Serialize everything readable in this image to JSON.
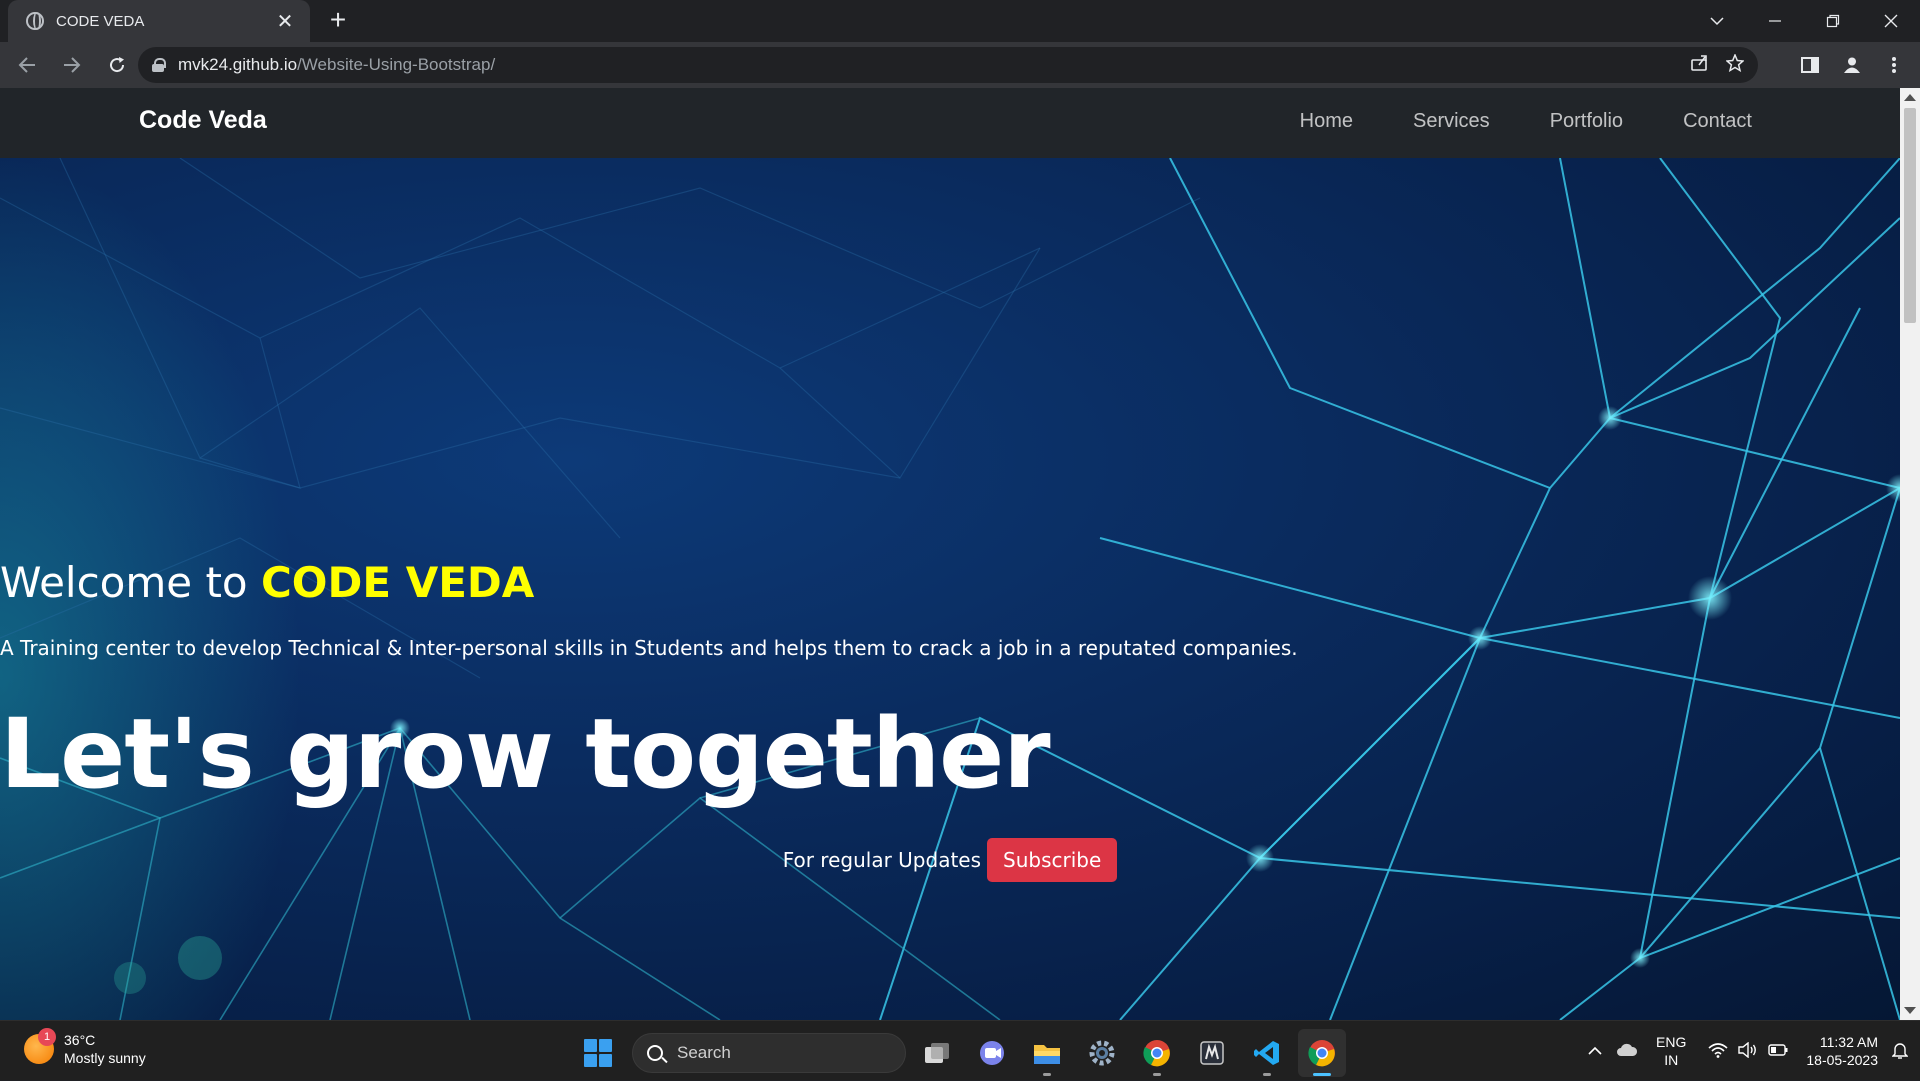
{
  "browser": {
    "tab_title": "CODE VEDA",
    "tab_close": "✕",
    "new_tab": "+",
    "url_host": "mvk24.github.io",
    "url_path": "/Website-Using-Bootstrap/"
  },
  "site": {
    "brand": "Code Veda",
    "nav": [
      "Home",
      "Services",
      "Portfolio",
      "Contact"
    ],
    "welcome_prefix": "Welcome to ",
    "welcome_highlight": "CODE VEDA",
    "tagline": "A Training center to develop Technical & Inter-personal skills in Students and helps them to crack a job in a reputated companies.",
    "headline": "Let's grow together",
    "updates_label": "For regular Updates",
    "subscribe_label": "Subscribe"
  },
  "taskbar": {
    "weather_temp": "36°C",
    "weather_desc": "Mostly sunny",
    "weather_badge": "1",
    "search_label": "Search",
    "lang_line1": "ENG",
    "lang_line2": "IN",
    "time": "11:32 AM",
    "date": "18-05-2023"
  },
  "colors": {
    "accent_yellow": "#ffff00",
    "subscribe_red": "#dc3545",
    "navbar_dark": "#212529"
  }
}
